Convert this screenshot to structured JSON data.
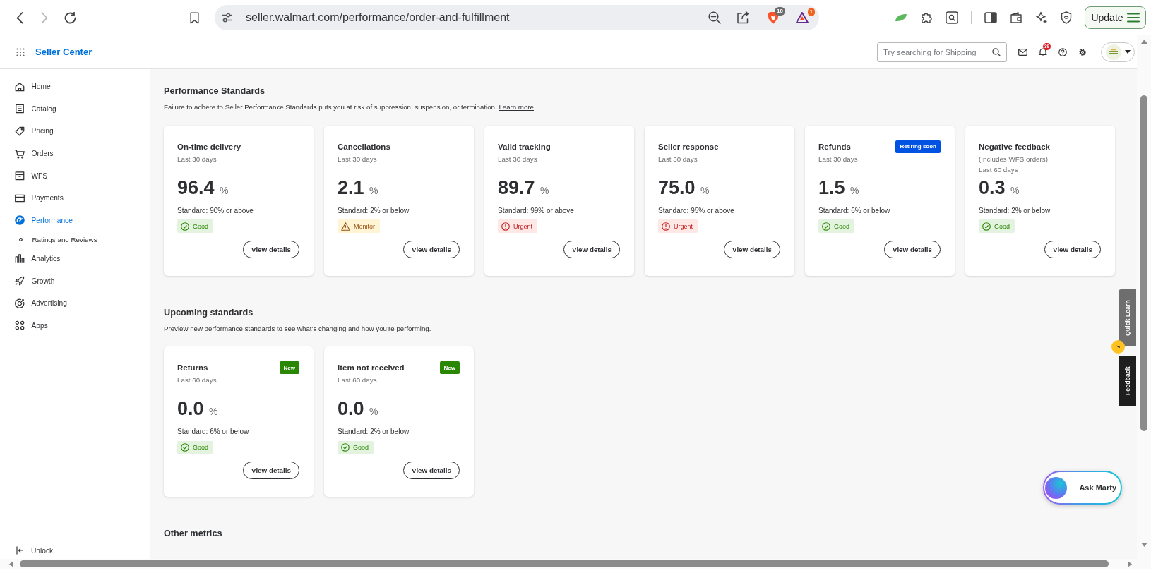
{
  "browser": {
    "nav_buttons": [
      {
        "disabled": false
      },
      {
        "disabled": true
      },
      {
        "disabled": false
      }
    ],
    "url": "seller.walmart.com/performance/order-and-fulfillment",
    "extension_badges": [
      "10",
      "1"
    ],
    "update_button": "Update"
  },
  "header": {
    "brand": "Seller Center",
    "search": {
      "placeholder": "Try searching for Shipping"
    },
    "notification_count": "39"
  },
  "sidebar": {
    "items": [
      {
        "label": "Home",
        "selected": false
      },
      {
        "label": "Catalog",
        "selected": false
      },
      {
        "label": "Pricing",
        "selected": false
      },
      {
        "label": "Orders",
        "selected": false
      },
      {
        "label": "WFS",
        "selected": false
      },
      {
        "label": "Payments",
        "selected": false
      },
      {
        "label": "Performance",
        "selected": true,
        "children": [
          {
            "label": "Ratings and Reviews",
            "selected": false
          }
        ]
      },
      {
        "label": "Analytics",
        "selected": false
      },
      {
        "label": "Growth",
        "selected": false
      },
      {
        "label": "Advertising",
        "selected": false
      },
      {
        "label": "Apps",
        "selected": false
      }
    ],
    "footer": "Unlock"
  },
  "sections": [
    {
      "title": "Performance Standards",
      "description": "Failure to adhere to Seller Performance Standards puts you at risk of suppression, suspension, or termination.",
      "link": "Learn more",
      "cards": [
        {
          "title": "On-time delivery",
          "notes": [
            "Last 30 days"
          ],
          "value": "96.4",
          "unit": "%",
          "standard": "Standard: 90% or above",
          "status": {
            "kind": "good",
            "label": "Good"
          },
          "button": "View details"
        },
        {
          "title": "Cancellations",
          "notes": [
            "Last 30 days"
          ],
          "value": "2.1",
          "unit": "%",
          "standard": "Standard: 2% or below",
          "status": {
            "kind": "monitor",
            "label": "Monitor"
          },
          "button": "View details"
        },
        {
          "title": "Valid tracking",
          "notes": [
            "Last 30 days"
          ],
          "value": "89.7",
          "unit": "%",
          "standard": "Standard: 99% or above",
          "status": {
            "kind": "urgent",
            "label": "Urgent"
          },
          "button": "View details"
        },
        {
          "title": "Seller response",
          "notes": [
            "Last 30 days"
          ],
          "value": "75.0",
          "unit": "%",
          "standard": "Standard: 95% or above",
          "status": {
            "kind": "urgent",
            "label": "Urgent"
          },
          "button": "View details"
        },
        {
          "title": "Refunds",
          "tag": {
            "kind": "retiring",
            "label": "Retiring soon"
          },
          "notes": [
            "Last 30 days"
          ],
          "value": "1.5",
          "unit": "%",
          "standard": "Standard: 6% or below",
          "status": {
            "kind": "good",
            "label": "Good"
          },
          "button": "View details"
        },
        {
          "title": "Negative feedback",
          "notes": [
            "(Includes WFS orders)",
            "Last 60 days"
          ],
          "value": "0.3",
          "unit": "%",
          "standard": "Standard: 2% or below",
          "status": {
            "kind": "good",
            "label": "Good"
          },
          "button": "View details"
        }
      ]
    },
    {
      "title": "Upcoming standards",
      "description": "Preview new performance standards to see what’s changing and how you’re performing.",
      "cards": [
        {
          "title": "Returns",
          "tag": {
            "kind": "new",
            "label": "New"
          },
          "notes": [
            "Last 60 days"
          ],
          "value": "0.0",
          "unit": "%",
          "standard": "Standard: 6% or below",
          "status": {
            "kind": "good",
            "label": "Good"
          },
          "button": "View details"
        },
        {
          "title": "Item not received",
          "tag": {
            "kind": "new",
            "label": "New"
          },
          "notes": [
            "Last 60 days"
          ],
          "value": "0.0",
          "unit": "%",
          "standard": "Standard: 2% or below",
          "status": {
            "kind": "good",
            "label": "Good"
          },
          "button": "View details"
        }
      ]
    },
    {
      "title": "Other metrics"
    }
  ],
  "side_tabs": [
    {
      "label": "Quick Learn",
      "badge": "7"
    },
    {
      "label": "Feedback"
    }
  ],
  "assistant_button": "Ask Marty"
}
